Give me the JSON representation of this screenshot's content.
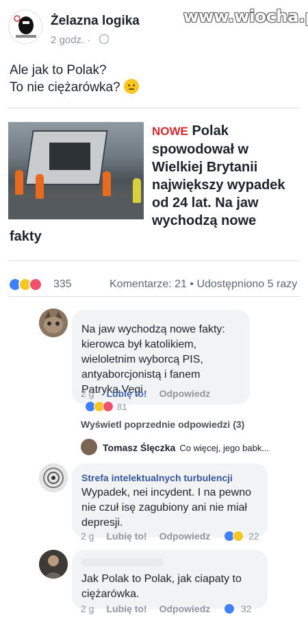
{
  "watermark": "www.wiocha.pl",
  "post": {
    "page_name": "Żelazna logika",
    "time": "2 godz. ·",
    "text_line1": "Ale jak to Polak?",
    "text_line2": "To nie ciężarówka?",
    "emoji_icon": "rolling-eyes-emoji"
  },
  "link_preview": {
    "badge": "NOWE",
    "title": "Polak spowodował w Wielkiej Brytanii największy wypadek od 24 lat. Na jaw wychodzą nowe",
    "title_tail": "fakty"
  },
  "reactions": {
    "icons": [
      "like-icon",
      "haha-icon",
      "love-icon"
    ],
    "count": "335",
    "comments": "Komentarze: 21",
    "shares": "Udostępniono 5 razy"
  },
  "comments": [
    {
      "text": "Na jaw wychodzą nowe fakty: kierowca był katolikiem, wieloletnim wyborcą PIS, antyaborcjonistą i fanem Patryka Vegi",
      "time": "2 g",
      "like": "Lubię to!",
      "reply": "Odpowiedz",
      "reaction_count": "81",
      "view_previous": "Wyświetl poprzednie odpowiedzi (3)",
      "reply_preview": {
        "author": "Tomasz Ślęczka",
        "snippet": "Co więcej, jego babk..."
      }
    },
    {
      "author": "Strefa intelektualnych turbulencji",
      "text": "Wypadek, nei incydent. I na pewno nie czuł isę zagubiony ani nie miał depresji.",
      "time": "2 g",
      "like": "Lubię to!",
      "reply": "Odpowiedz",
      "reaction_count": "22"
    },
    {
      "text": "Jak Polak to Polak, jak ciapaty to ciężarówka.",
      "time": "2 g",
      "like": "Lubię to!",
      "reply": "Odpowiedz",
      "reaction_count": "32"
    }
  ],
  "colors": {
    "facebook_blue": "#4267b2",
    "link_author": "#365899",
    "bubble_bg": "#f2f3f5",
    "badge_red": "#d7282f"
  }
}
